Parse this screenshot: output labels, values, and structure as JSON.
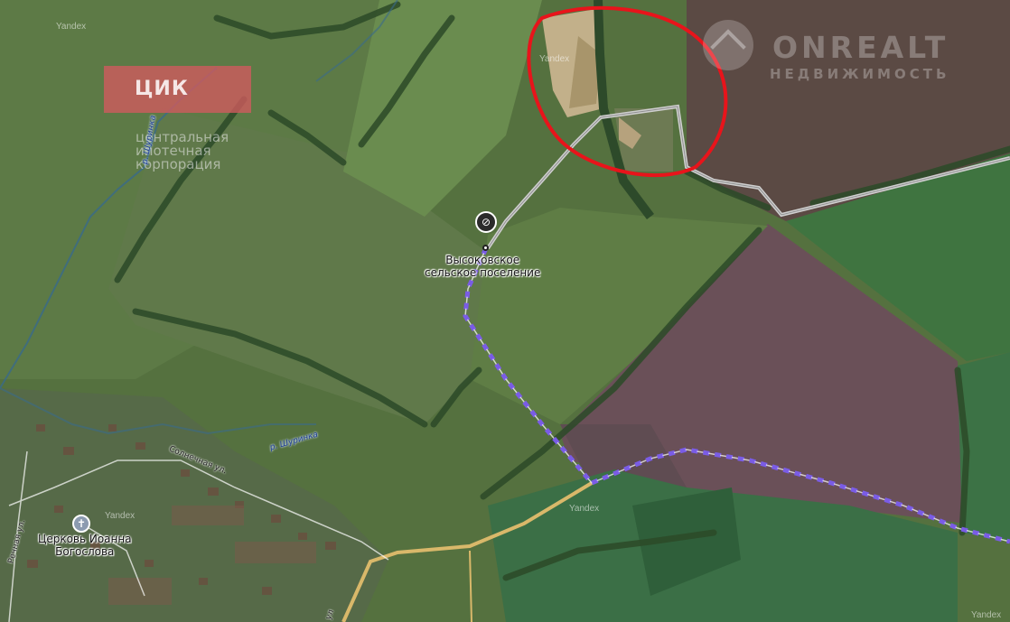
{
  "watermarks": {
    "cik_title": "ЦИК",
    "cik_subtitle": "центральная\nипотечная\nкорпорация",
    "onrealt_title": "ONREALT",
    "onrealt_subtitle": "НЕДВИЖИМОСТЬ",
    "yandex": [
      "Yandex",
      "Yandex",
      "Yandex",
      "Yandex",
      "Yandex"
    ]
  },
  "places": {
    "settlement": "Высоковское\nсельское поселение",
    "church": "Церковь Иоанна\nБогослова"
  },
  "streets": {
    "solnechnaya": "Солнечная ул.",
    "rechnaya": "Речная ул.",
    "vertical_road": "ул"
  },
  "rivers": {
    "shurinka": "р. Шуринка",
    "stream": "р. Шуринка"
  },
  "icons": {
    "settlement_pin": "cancel-circle-icon",
    "church_pin": "cross-icon",
    "highlight": "red-ellipse-annotation",
    "route": "purple-dashed-route"
  },
  "colors": {
    "annotation_red": "#e8141b",
    "route_purple": "#7a5ce6",
    "road_yellow": "#d9b86a",
    "road_gray": "#c9c9c9"
  }
}
